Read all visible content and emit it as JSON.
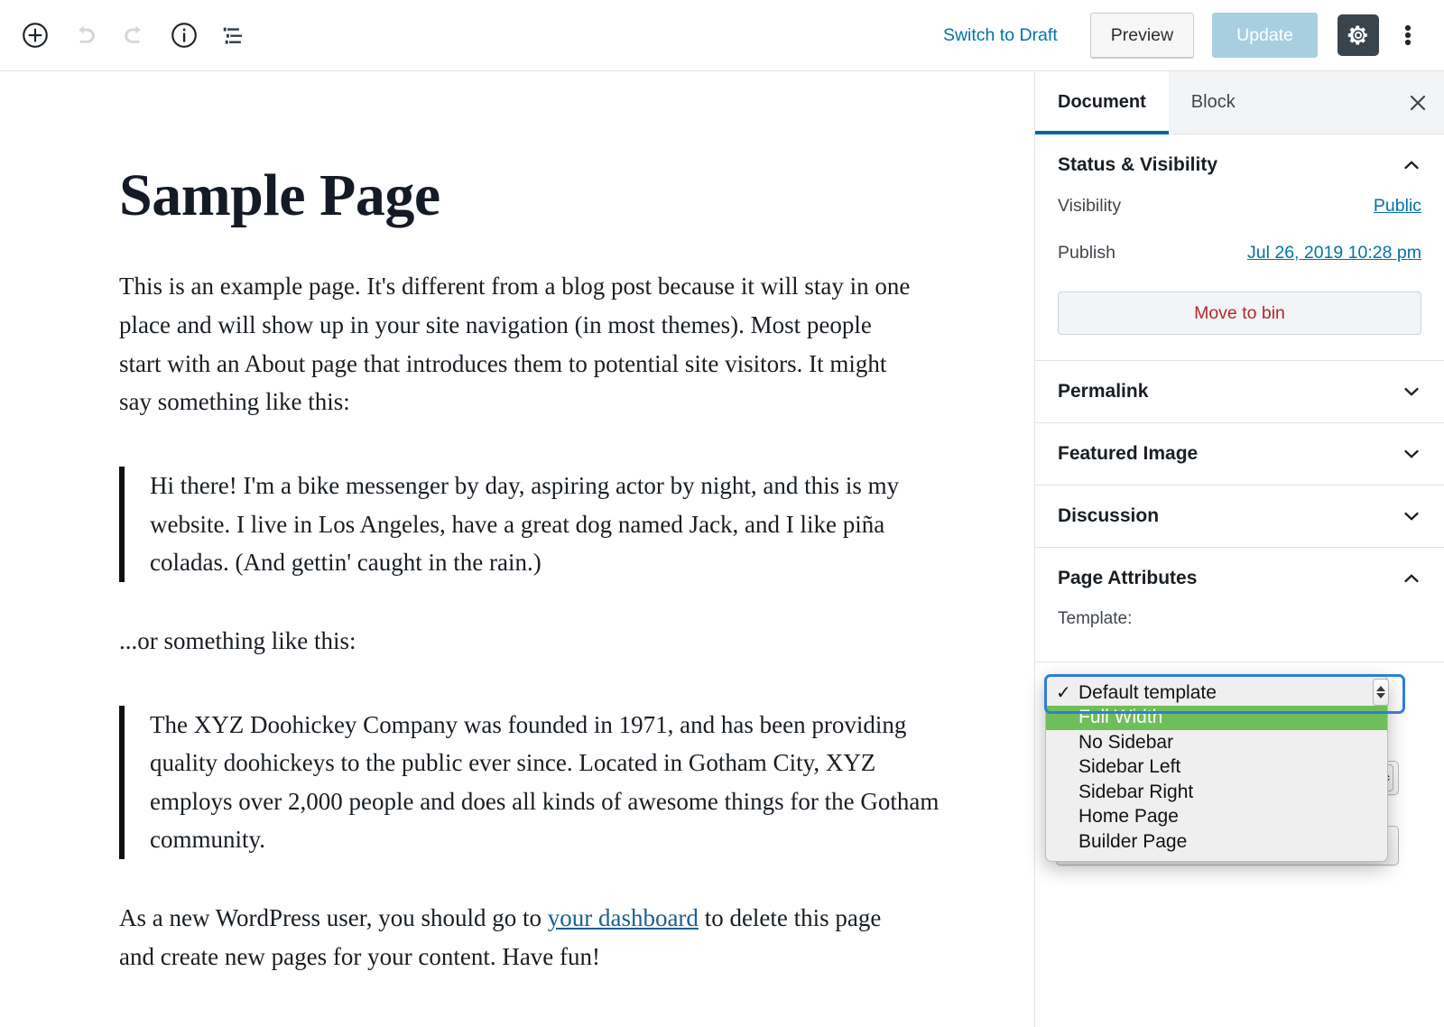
{
  "header": {
    "icons": [
      {
        "name": "add-block-icon",
        "label": "Add block"
      },
      {
        "name": "undo-icon",
        "label": "Undo"
      },
      {
        "name": "redo-icon",
        "label": "Redo"
      },
      {
        "name": "content-info-icon",
        "label": "Content structure"
      },
      {
        "name": "block-navigation-icon",
        "label": "Block navigation"
      }
    ],
    "switch_to_draft": "Switch to Draft",
    "preview_label": "Preview",
    "update_label": "Update",
    "settings_icon": "gear-icon",
    "more_icon": "kebab-menu-icon",
    "accent_link_color": "#0073aa",
    "update_disabled_color": "#a7cfdf",
    "gear_button_color": "#39444d"
  },
  "editor": {
    "title": "Sample Page",
    "blocks": [
      {
        "type": "paragraph",
        "text": "This is an example page. It's different from a blog post because it will stay in one place and will show up in your site navigation (in most themes). Most people start with an About page that introduces them to potential site visitors. It might say something like this:"
      },
      {
        "type": "quote",
        "text": "Hi there! I'm a bike messenger by day, aspiring actor by night, and this is my website. I live in Los Angeles, have a great dog named Jack, and I like piña coladas. (And gettin' caught in the rain.)"
      },
      {
        "type": "paragraph",
        "text": "...or something like this:"
      },
      {
        "type": "quote",
        "text": "The XYZ Doohickey Company was founded in 1971, and has been providing quality doohickeys to the public ever since. Located in Gotham City, XYZ employs over 2,000 people and does all kinds of awesome things for the Gotham community."
      },
      {
        "type": "paragraph-with-link",
        "text_before": "As a new WordPress user, you should go to ",
        "link_text": "your dashboard",
        "text_after": " to delete this page and create new pages for your content. Have fun!",
        "link_color": "#1a6091"
      }
    ]
  },
  "sidebar": {
    "tabs": [
      {
        "label": "Document",
        "active": true
      },
      {
        "label": "Block",
        "active": false
      }
    ],
    "close_icon": "close-icon",
    "status_panel": {
      "title": "Status & Visibility",
      "expanded": true,
      "chevron": "chevron-up-icon",
      "visibility_label": "Visibility",
      "visibility_value": "Public",
      "publish_label": "Publish",
      "publish_value": "Jul 26, 2019 10:28 pm",
      "trash_label": "Move to bin",
      "trash_color": "#b52727"
    },
    "collapsed_panels": [
      {
        "title": "Permalink",
        "chevron": "chevron-down-icon"
      },
      {
        "title": "Featured Image",
        "chevron": "chevron-down-icon"
      },
      {
        "title": "Discussion",
        "chevron": "chevron-down-icon"
      }
    ],
    "page_attributes": {
      "title": "Page Attributes",
      "expanded": true,
      "chevron": "chevron-up-icon",
      "template_label": "Template:",
      "template_selected": "Default template"
    }
  },
  "template_dropdown": {
    "open": true,
    "highlight_color": "#6ebe59",
    "focus_ring_color": "#2f7fd4",
    "options": [
      {
        "label": "Default template",
        "checked": true,
        "highlighted": false
      },
      {
        "label": "Full Width",
        "checked": false,
        "highlighted": true
      },
      {
        "label": "No Sidebar",
        "checked": false,
        "highlighted": false
      },
      {
        "label": "Sidebar Left",
        "checked": false,
        "highlighted": false
      },
      {
        "label": "Sidebar Right",
        "checked": false,
        "highlighted": false
      },
      {
        "label": "Home Page",
        "checked": false,
        "highlighted": false
      },
      {
        "label": "Builder Page",
        "checked": false,
        "highlighted": false
      }
    ]
  }
}
